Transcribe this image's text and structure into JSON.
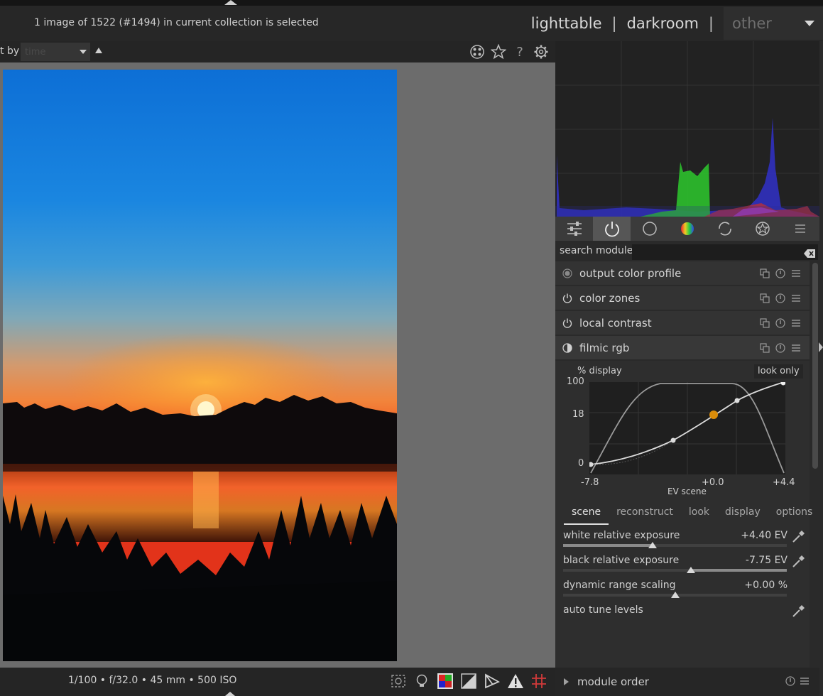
{
  "header": {
    "selection_info": "1 image of 1522 (#1494) in current collection is selected",
    "views": {
      "lighttable": "lighttable",
      "separator": "|",
      "darkroom": "darkroom",
      "other": "other"
    }
  },
  "sort_bar": {
    "label": "t by",
    "sort_value": "time",
    "icons": [
      "grouping-icon",
      "star-icon",
      "help-icon",
      "gear-icon"
    ]
  },
  "bottom_bar": {
    "exif": "1/100 • f/32.0 • 45 mm • 500 ISO",
    "tools": [
      "focus-peaking-icon",
      "bulb-icon",
      "color-assessment-icon",
      "softproof-icon",
      "gamut-check-icon",
      "overexposed-warning-icon",
      "guides-icon"
    ]
  },
  "module_groups": {
    "tabs": [
      "quick-access-icon",
      "active-modules-icon",
      "base-icon",
      "color-icon",
      "correct-icon",
      "effect-icon",
      "presets-menu-icon"
    ],
    "active_index": 1
  },
  "search": {
    "label": "search module",
    "placeholder": ""
  },
  "modules": [
    {
      "name": "output color profile",
      "state": "always-on"
    },
    {
      "name": "color zones",
      "state": "off"
    },
    {
      "name": "local contrast",
      "state": "off"
    },
    {
      "name": "filmic rgb",
      "state": "expanded"
    }
  ],
  "filmic": {
    "graph": {
      "y_axis_label": "% display",
      "look_only": "look only",
      "y_ticks": [
        "100",
        "18",
        "0"
      ],
      "x_ticks": [
        "-7.8",
        "+0.0",
        "+4.4"
      ],
      "x_axis_label": "EV scene"
    },
    "tabs": [
      "scene",
      "reconstruct",
      "look",
      "display",
      "options"
    ],
    "active_tab": "scene",
    "sliders": [
      {
        "label": "white relative exposure",
        "value": "+4.40 EV",
        "position": 0.4,
        "fill": "left"
      },
      {
        "label": "black relative exposure",
        "value": "-7.75 EV",
        "position": 0.57,
        "fill": "right"
      },
      {
        "label": "dynamic range scaling",
        "value": "+0.00 %",
        "position": 0.5,
        "fill": "none"
      }
    ],
    "auto_tune": {
      "label": "auto tune levels"
    }
  },
  "module_order": {
    "label": "module order"
  },
  "colors": {
    "accent_orange": "#d98c0a",
    "panel_bg": "#2a2a2a"
  }
}
